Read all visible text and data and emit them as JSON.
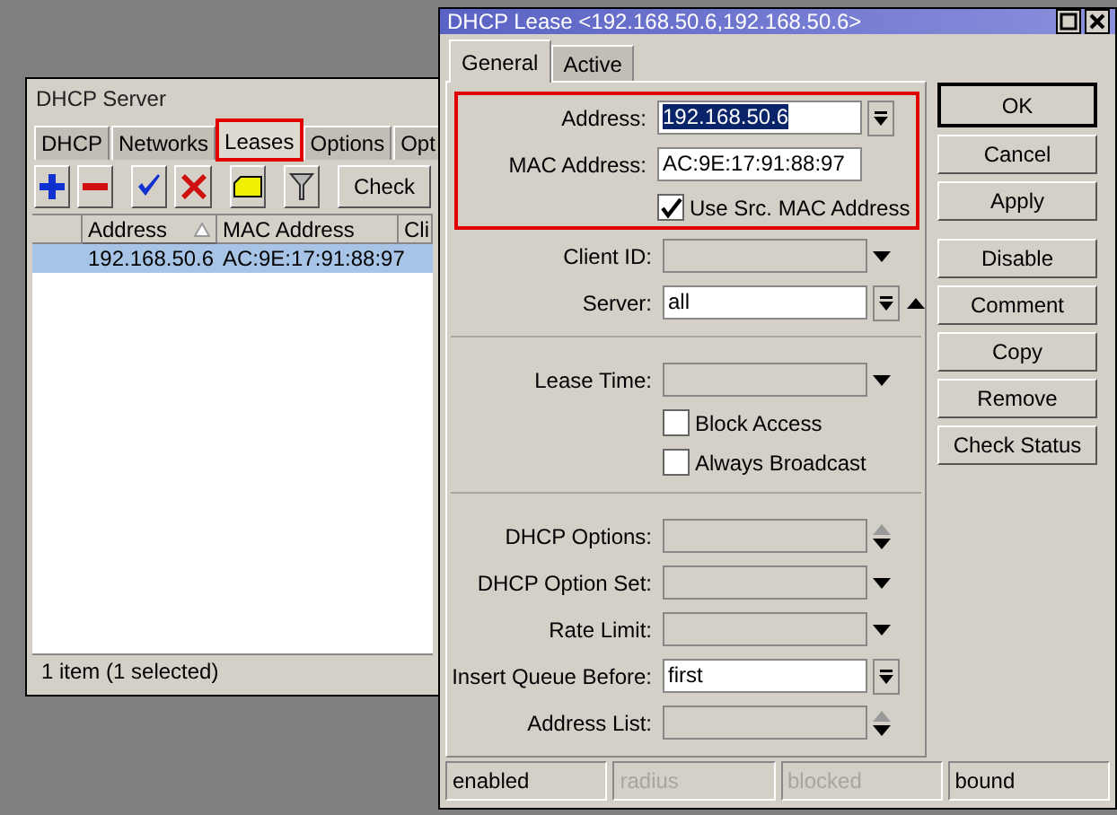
{
  "server_window": {
    "title": "DHCP Server",
    "tabs": [
      {
        "label": "DHCP",
        "selected": false,
        "highlighted": false
      },
      {
        "label": "Networks",
        "selected": false,
        "highlighted": false
      },
      {
        "label": "Leases",
        "selected": true,
        "highlighted": true
      },
      {
        "label": "Options",
        "selected": false,
        "highlighted": false
      },
      {
        "label": "Opt",
        "selected": false,
        "highlighted": false
      }
    ],
    "toolbar_button": "Check",
    "columns": [
      {
        "label": "Address",
        "sorted": true
      },
      {
        "label": "MAC Address",
        "sorted": false
      },
      {
        "label": "Cli",
        "sorted": false
      }
    ],
    "rows": [
      {
        "selected": true,
        "cells": [
          "192.168.50.6",
          "AC:9E:17:91:88:97"
        ]
      }
    ],
    "status_bar": "1 item (1 selected)"
  },
  "lease_window": {
    "title": "DHCP Lease <192.168.50.6,192.168.50.6>",
    "tabs": [
      {
        "label": "General",
        "selected": true
      },
      {
        "label": "Active",
        "selected": false
      }
    ],
    "sections": [
      {
        "framed_rows": [
          {
            "kind": "field",
            "label": "Address:",
            "value": "192.168.50.6",
            "text_selected": true,
            "control": {
              "kind": "box"
            }
          },
          {
            "kind": "field",
            "label": "MAC Address:",
            "value": "AC:9E:17:91:88:97",
            "text_selected": false
          },
          {
            "kind": "checkbox",
            "label": "Use Src. MAC Address",
            "checked": true
          }
        ],
        "rows": [
          {
            "kind": "field",
            "label": "Client ID:",
            "control": {
              "kind": "down"
            }
          },
          {
            "kind": "field",
            "label": "Server:",
            "value": "all",
            "text_selected": false,
            "control": {
              "kind": "box-up"
            }
          }
        ]
      },
      {
        "rows": [
          {
            "kind": "field",
            "label": "Lease Time:",
            "control": {
              "kind": "down"
            }
          },
          {
            "kind": "checkbox",
            "label": "Block Access",
            "checked": false
          },
          {
            "kind": "checkbox",
            "label": "Always Broadcast",
            "checked": false
          }
        ]
      },
      {
        "rows": [
          {
            "kind": "field",
            "label": "DHCP Options:",
            "control": {
              "kind": "updown"
            }
          },
          {
            "kind": "field",
            "label": "DHCP Option Set:",
            "control": {
              "kind": "down"
            }
          },
          {
            "kind": "field",
            "label": "Rate Limit:",
            "control": {
              "kind": "down"
            }
          },
          {
            "kind": "field",
            "label": "Insert Queue Before:",
            "value": "first",
            "text_selected": false,
            "control": {
              "kind": "box"
            }
          },
          {
            "kind": "field",
            "label": "Address List:",
            "control": {
              "kind": "updown"
            }
          }
        ]
      }
    ],
    "button_groups": [
      [
        {
          "label": "OK",
          "default": true
        },
        {
          "label": "Cancel",
          "default": false
        },
        {
          "label": "Apply",
          "default": false
        }
      ],
      [
        {
          "label": "Disable",
          "default": false
        },
        {
          "label": "Comment",
          "default": false
        },
        {
          "label": "Copy",
          "default": false
        },
        {
          "label": "Remove",
          "default": false
        },
        {
          "label": "Check Status",
          "default": false
        }
      ]
    ],
    "status_bar": [
      {
        "text": "enabled",
        "disabled": false
      },
      {
        "text": "radius",
        "disabled": true
      },
      {
        "text": "blocked",
        "disabled": true
      },
      {
        "text": "bound",
        "disabled": false
      }
    ]
  }
}
